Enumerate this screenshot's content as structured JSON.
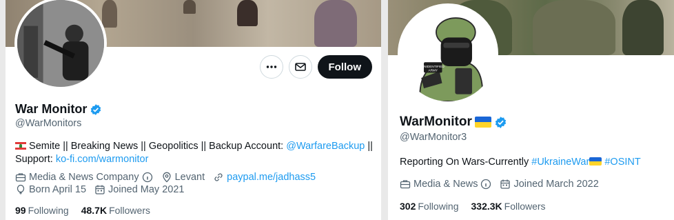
{
  "left_profile": {
    "name": "War Monitor",
    "handle": "@WarMonitors",
    "bio_line1": "Semite || Breaking News || Geopolitics || Backup Account: ",
    "bio_link1": "@WarfareBackup",
    "bio_line1_end": " ||",
    "bio_line2_prefix": "Support: ",
    "bio_link2": "ko-fi.com/warmonitor",
    "category": "Media & News Company",
    "location": "Levant",
    "website": "paypal.me/jadhass5",
    "born": "Born April 15",
    "joined": "Joined May 2021",
    "following_count": "99",
    "following_label": "Following",
    "followers_count": "48.7K",
    "followers_label": "Followers",
    "follow_label": "Follow"
  },
  "right_profile": {
    "name": "WarMonitor",
    "handle": "@WarMonitor3",
    "bio_text": "Reporting On Wars-Currently ",
    "hashtag1": "#UkraineWar",
    "hashtag2": "#OSINT",
    "category": "Media & News",
    "joined": "Joined March 2022",
    "following_count": "302",
    "following_label": "Following",
    "followers_count": "332.3K",
    "followers_label": "Followers",
    "avatar_patch_text": "UNIDENTIFIED ARMY"
  },
  "colors": {
    "verified": "#1d9bf0",
    "link": "#1d9bf0",
    "follow_bg": "#0f1419"
  }
}
